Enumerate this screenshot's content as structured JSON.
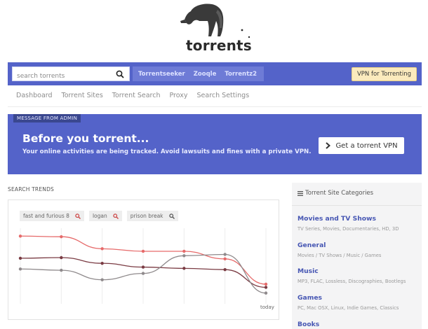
{
  "logo": {
    "text": "torrents",
    "icon": "anteater-icon"
  },
  "search": {
    "placeholder": "search torrents",
    "engines": [
      "Torrentseeker",
      "Zooqle",
      "Torrentz2"
    ],
    "vpn_button": "VPN for Torrenting"
  },
  "nav": {
    "items": [
      "Dashboard",
      "Torrent Sites",
      "Torrent Search",
      "Proxy",
      "Search Settings"
    ]
  },
  "admin": {
    "tag": "MESSAGE FROM ADMIN",
    "title": "Before you torrent...",
    "text": "Your online activities are being tracked. Avoid lawsuits and fines with a private VPN.",
    "button": "Get a torrent VPN"
  },
  "trends": {
    "title": "SEARCH TRENDS",
    "chips": [
      "fast and furious 8",
      "logan",
      "prison break"
    ],
    "x_end_label": "today",
    "colors": {
      "series1": "#e66a6a",
      "series2": "#7a3b43",
      "series3": "#8f8a8c"
    }
  },
  "chart_data": {
    "type": "line",
    "x_end_label": "today",
    "grid": true,
    "series": [
      {
        "name": "fast and furious 8",
        "values": [
          82,
          81,
          62,
          58,
          58,
          46,
          6
        ]
      },
      {
        "name": "logan",
        "values": [
          47,
          48,
          39,
          33,
          31,
          29,
          1
        ]
      },
      {
        "name": "prison break",
        "values": [
          30,
          28,
          13,
          23,
          51,
          53,
          -8
        ]
      }
    ],
    "ylim": [
      -25,
      100
    ]
  },
  "sidebar": {
    "title": "Torrent Site Categories",
    "categories": [
      {
        "name": "Movies and TV Shows",
        "desc": "TV Series, Movies, Documentaries, HD, 3D"
      },
      {
        "name": "General",
        "desc": "Movies / TV Shows / Music / Games"
      },
      {
        "name": "Music",
        "desc": "MP3, FLAC, Lossless, Discographies, Bootlegs"
      },
      {
        "name": "Games",
        "desc": "PC, Mac OSX, Linux, Indie Games, Classics"
      },
      {
        "name": "Books",
        "desc": ""
      }
    ]
  }
}
